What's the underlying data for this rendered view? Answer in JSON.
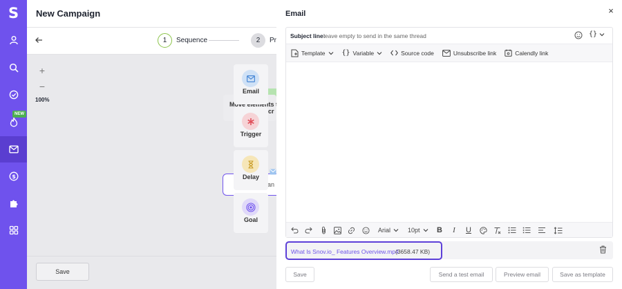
{
  "app": {
    "logo": "S",
    "page_title": "New Campaign",
    "new_badge": "NEW"
  },
  "sidebar": {
    "items": [
      {
        "icon": "user-icon"
      },
      {
        "icon": "search-icon"
      },
      {
        "icon": "check-circle-icon"
      },
      {
        "icon": "flame-icon",
        "badge": "NEW"
      },
      {
        "icon": "mail-icon",
        "active": true
      },
      {
        "icon": "dollar-icon"
      },
      {
        "icon": "puzzle-icon"
      },
      {
        "icon": "apps-grid-icon"
      }
    ]
  },
  "steps": [
    {
      "number": "1",
      "label": "Sequence"
    },
    {
      "number": "2",
      "label": "Pro"
    }
  ],
  "canvas": {
    "zoom_in": "+",
    "zoom_out": "−",
    "zoom_level": "100%",
    "hint_line1": "Move elements t",
    "hint_line2": "o cr",
    "node_text": "Set an",
    "palette": [
      {
        "label": "Email",
        "icon": "mail-icon"
      },
      {
        "label": "Trigger",
        "icon": "asterisk-icon"
      },
      {
        "label": "Delay",
        "icon": "hourglass-icon"
      },
      {
        "label": "Goal",
        "icon": "target-icon"
      }
    ]
  },
  "footer": {
    "save_label": "Save"
  },
  "modal": {
    "title": "Email",
    "close": "×",
    "subject": {
      "label": "Subject line:",
      "placeholder": "leave empty to send in the same thread",
      "variable_label": "{}"
    },
    "toolbar": {
      "template": "Template",
      "variable": "Variable",
      "source_code": "Source code",
      "unsubscribe": "Unsubscribe link",
      "calendly": "Calendly link"
    },
    "format": {
      "font": "Arial",
      "size": "10pt",
      "bold": "B",
      "italic": "I",
      "underline": "U"
    },
    "attachment": {
      "name": "What Is Snov.io_ Features Overview.mp4",
      "size": "(3658.47 KB)"
    },
    "buttons": {
      "save": "Save",
      "test": "Send a test email",
      "preview": "Preview email",
      "save_template": "Save as template"
    }
  },
  "colors": {
    "brand": "#6f52ed",
    "accent_border": "#5c3fd8",
    "step_done": "#8bc34a"
  }
}
